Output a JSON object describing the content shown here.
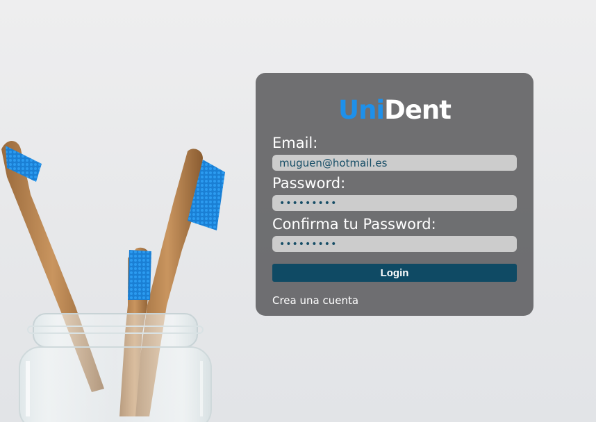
{
  "app": {
    "logo_part1": "Uni",
    "logo_part2": "Dent"
  },
  "form": {
    "email_label": "Email:",
    "email_value": "muguen@hotmail.es",
    "password_label": "Password:",
    "password_value": "123456789",
    "confirm_label": "Confirma tu Password:",
    "confirm_value": "123456789",
    "login_label": "Login",
    "create_account_label": "Crea una cuenta"
  },
  "colors": {
    "accent": "#1e90ea",
    "button": "#0f4a64",
    "card": "#646466",
    "input_bg": "#cccccc",
    "input_text": "#164d66"
  }
}
